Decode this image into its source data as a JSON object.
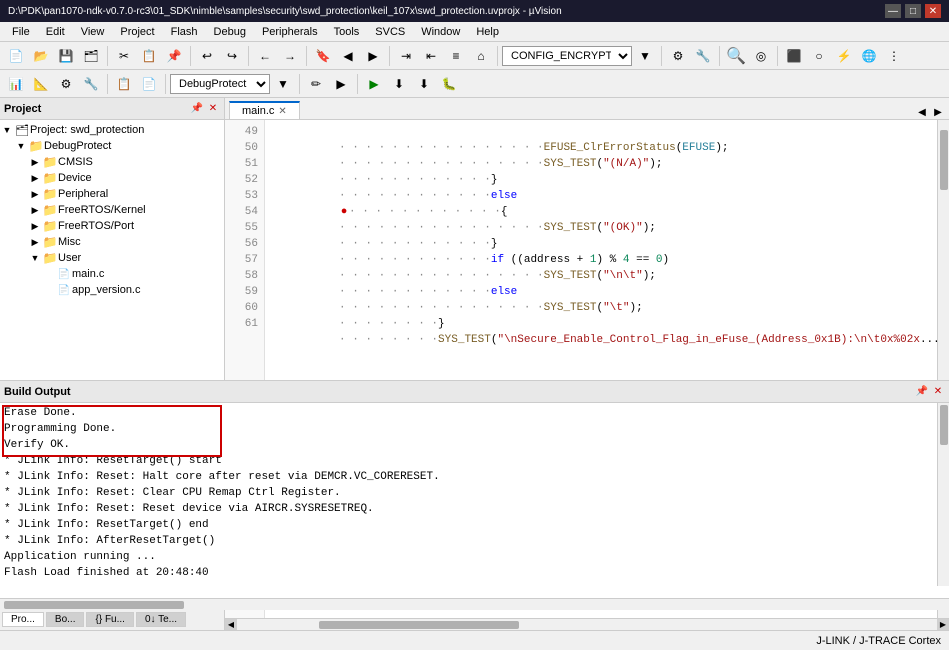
{
  "titleBar": {
    "text": "D:\\PDK\\pan1070-ndk-v0.7.0-rc3\\01_SDK\\nimble\\samples\\security\\swd_protection\\keil_107x\\swd_protection.uvprojx - µVision"
  },
  "menuBar": {
    "items": [
      "File",
      "Edit",
      "View",
      "Project",
      "Flash",
      "Debug",
      "Peripherals",
      "Tools",
      "SVCS",
      "Window",
      "Help"
    ]
  },
  "toolbar": {
    "debugProtect": "DebugProtect"
  },
  "tabs": {
    "editor": [
      {
        "label": "main.c",
        "active": true
      }
    ]
  },
  "project": {
    "title": "Project",
    "rootLabel": "Project: swd_protection",
    "items": [
      {
        "id": "debugprotect",
        "label": "DebugProtect",
        "level": 1,
        "expanded": true,
        "type": "folder"
      },
      {
        "id": "cmsis",
        "label": "CMSIS",
        "level": 2,
        "expanded": false,
        "type": "folder"
      },
      {
        "id": "device",
        "label": "Device",
        "level": 2,
        "expanded": false,
        "type": "folder"
      },
      {
        "id": "peripheral",
        "label": "Peripheral",
        "level": 2,
        "expanded": false,
        "type": "folder"
      },
      {
        "id": "freertos-kernel",
        "label": "FreeRTOS/Kernel",
        "level": 2,
        "expanded": false,
        "type": "folder"
      },
      {
        "id": "freertos-port",
        "label": "FreeRTOS/Port",
        "level": 2,
        "expanded": false,
        "type": "folder"
      },
      {
        "id": "misc",
        "label": "Misc",
        "level": 2,
        "expanded": false,
        "type": "folder"
      },
      {
        "id": "user",
        "label": "User",
        "level": 2,
        "expanded": true,
        "type": "folder"
      },
      {
        "id": "main-c",
        "label": "main.c",
        "level": 3,
        "type": "file"
      },
      {
        "id": "app-version-c",
        "label": "app_version.c",
        "level": 3,
        "type": "file"
      }
    ]
  },
  "code": {
    "lines": [
      {
        "num": 49,
        "text": "                EFUSE_ClrErrorStatus(EFUSE);"
      },
      {
        "num": 50,
        "text": "                SYS_TEST(\"(N/A)\");"
      },
      {
        "num": 51,
        "text": "            }"
      },
      {
        "num": 52,
        "text": "            else"
      },
      {
        "num": 53,
        "text": "            {",
        "marker": true
      },
      {
        "num": 54,
        "text": "                SYS_TEST(\"(OK)\");"
      },
      {
        "num": 55,
        "text": "            }"
      },
      {
        "num": 56,
        "text": "            if ((address + 1) % 4 == 0)"
      },
      {
        "num": 57,
        "text": "                SYS_TEST(\"\\n\\t\");"
      },
      {
        "num": 58,
        "text": "            else"
      },
      {
        "num": 59,
        "text": "                SYS_TEST(\"\\t\");"
      },
      {
        "num": 60,
        "text": "        }"
      },
      {
        "num": 61,
        "text": "        SYS_TEST(\"\\nSecure_Enable_Control_Flag_in_eFuse_(Address_0x1B):\\n\\t0x%02x",
        "truncated": true
      }
    ]
  },
  "buildOutput": {
    "title": "Build Output",
    "lines": [
      "Erase Done.",
      "Programming Done.",
      "Verify OK.",
      "* JLink Info: ResetTarget() start",
      "* JLink Info: Reset: Halt core after reset via DEMCR.VC_CORERESET.",
      "* JLink Info: Reset: Clear CPU Remap Ctrl Register.",
      "* JLink Info: Reset: Reset device via AIRCR.SYSRESETREQ.",
      "* JLink Info: ResetTarget() end",
      "* JLink Info: AfterResetTarget()",
      "Application running ...",
      "Flash Load finished at 20:48:40"
    ]
  },
  "bottomTabs": [
    "Pro...",
    "Bo...",
    "{} Fu...",
    "0↓ Te..."
  ],
  "statusBar": {
    "text": "J-LINK / J-TRACE Cortex"
  },
  "icons": {
    "expand": "▶",
    "collapse": "▼",
    "folder": "📁",
    "file": "📄",
    "close": "✕",
    "pin": "📌",
    "minimize": "—",
    "maximize": "□",
    "winClose": "✕"
  }
}
